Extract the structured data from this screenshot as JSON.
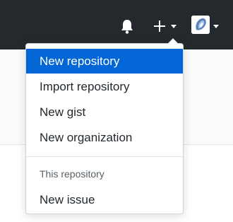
{
  "header": {
    "icons": {
      "notifications": "bell-icon",
      "create": "plus-icon",
      "create_caret": "caret-down-icon",
      "profile": "avatar",
      "profile_caret": "caret-down-icon"
    }
  },
  "create_menu": {
    "items": [
      {
        "label": "New repository",
        "active": true
      },
      {
        "label": "Import repository",
        "active": false
      },
      {
        "label": "New gist",
        "active": false
      },
      {
        "label": "New organization",
        "active": false
      }
    ],
    "section_header": "This repository",
    "section_items": [
      {
        "label": "New issue",
        "active": false
      }
    ]
  },
  "colors": {
    "header_bg": "#24292e",
    "active_item_bg": "#0366d6",
    "menu_text": "#24292e",
    "section_header_text": "#586069"
  }
}
